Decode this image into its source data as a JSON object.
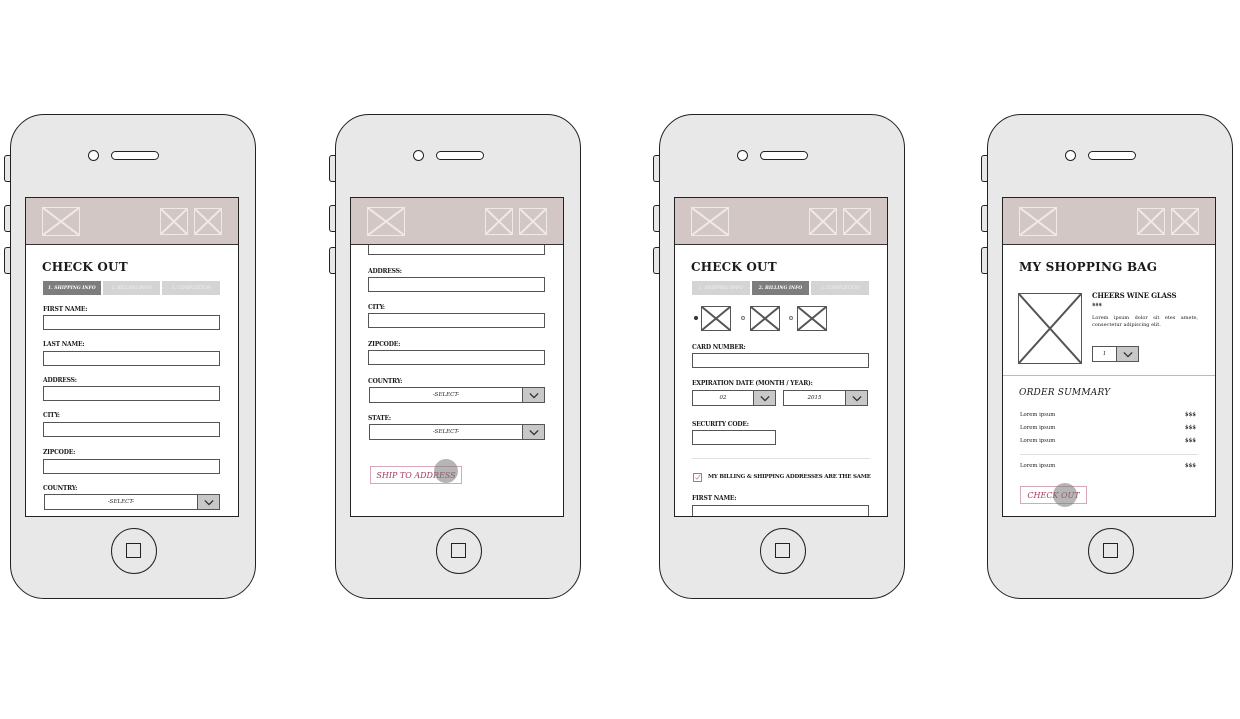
{
  "screens": [
    {
      "title": "CHECK OUT",
      "tabs": [
        "1. SHIPPING INFO",
        "2. BILLING INFO",
        "3. COMPLETION"
      ],
      "active_tab": 0,
      "fields": [
        {
          "label": "FIRST NAME:",
          "value": ""
        },
        {
          "label": "LAST NAME:",
          "value": ""
        },
        {
          "label": "ADDRESS:",
          "value": ""
        },
        {
          "label": "CITY:",
          "value": ""
        },
        {
          "label": "ZIPCODE:",
          "value": ""
        }
      ],
      "selects": [
        {
          "label": "COUNTRY:",
          "value": "-SELECT-"
        }
      ]
    },
    {
      "fields": [
        {
          "label": "",
          "value": ""
        },
        {
          "label": "ADDRESS:",
          "value": ""
        },
        {
          "label": "CITY:",
          "value": ""
        },
        {
          "label": "ZIPCODE:",
          "value": ""
        }
      ],
      "selects": [
        {
          "label": "COUNTRY:",
          "value": "-SELECT-"
        },
        {
          "label": "STATE:",
          "value": "-SELECT-"
        }
      ],
      "submit_label": "SHIP TO ADDRESS"
    },
    {
      "title": "CHECK OUT",
      "tabs": [
        "1. SHIPPING INFO",
        "2. BILLING INFO",
        "3. COMPLETION"
      ],
      "active_tab": 1,
      "card_options_selected": 0,
      "card_number_label": "CARD NUMBER:",
      "expiration_label": "EXPIRATION DATE (MONTH / YEAR):",
      "expiration_month": "02",
      "expiration_year": "2015",
      "security_code_label": "SECURITY CODE:",
      "same_address_label": "MY BILLING & SHIPPING ADDRESSES ARE THE SAME",
      "same_address_checked": true,
      "first_name_label": "FIRST NAME:"
    },
    {
      "title": "MY SHOPPING BAG",
      "product": {
        "name": "CHEERS WINE GLASS",
        "price": "$$$",
        "description": "Lorem ipsum dolor sit etes amete, consectetur adipiscing elit.",
        "quantity": "1"
      },
      "summary_title": "ORDER SUMMARY",
      "summary_rows": [
        {
          "label": "Lorem ipsum",
          "amount": "$$$"
        },
        {
          "label": "Lorem ipsum",
          "amount": "$$$"
        },
        {
          "label": "Lorem ipsum",
          "amount": "$$$"
        }
      ],
      "summary_total": {
        "label": "Lorem ipsum",
        "amount": "$$$"
      },
      "checkout_label": "CHECK OUT"
    }
  ],
  "icons": {
    "placeholder": "image-placeholder-icon",
    "chevron": "chevron-down-icon",
    "home": "home-button-icon"
  },
  "colors": {
    "header_bg": "#d3c7c5",
    "accent": "#a33a58",
    "tab_active": "#7d7d7d",
    "tab_inactive": "#d4d4d4",
    "device_body": "#e8e8e8"
  }
}
